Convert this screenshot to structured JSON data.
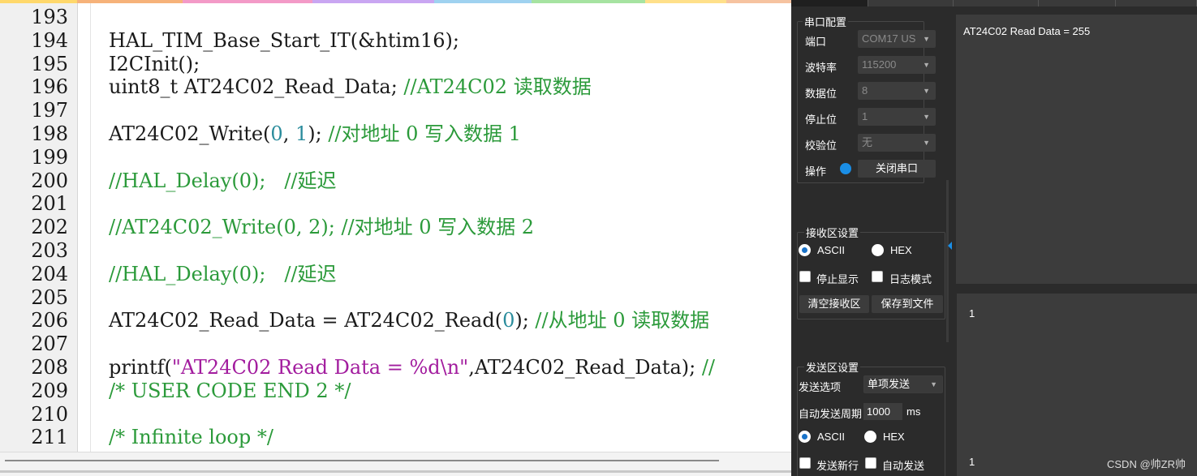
{
  "editor": {
    "tab_colors": [
      "#ffd86b",
      "#f6b27a",
      "#f39ac7",
      "#c9a6f2",
      "#9fd2f0",
      "#a6e3a1",
      "#ffe08a",
      "#f6c3a0"
    ],
    "lines": [
      {
        "n": "193",
        "tokens": []
      },
      {
        "n": "194",
        "tokens": [
          {
            "t": "HAL_TIM_Base_Start_IT(&htim16);",
            "c": ""
          }
        ]
      },
      {
        "n": "195",
        "tokens": [
          {
            "t": "I2CInit();",
            "c": ""
          }
        ]
      },
      {
        "n": "196",
        "tokens": [
          {
            "t": "uint8_t AT24C02_Read_Data; ",
            "c": ""
          },
          {
            "t": "//AT24C02 读取数据",
            "c": "cm"
          }
        ]
      },
      {
        "n": "197",
        "tokens": []
      },
      {
        "n": "198",
        "tokens": [
          {
            "t": "AT24C02_Write(",
            "c": ""
          },
          {
            "t": "0",
            "c": "num"
          },
          {
            "t": ", ",
            "c": ""
          },
          {
            "t": "1",
            "c": "num"
          },
          {
            "t": "); ",
            "c": ""
          },
          {
            "t": "//对地址 0 写入数据 1",
            "c": "cm"
          }
        ]
      },
      {
        "n": "199",
        "tokens": []
      },
      {
        "n": "200",
        "tokens": [
          {
            "t": "//HAL_Delay(0);   //延迟",
            "c": "cm"
          }
        ]
      },
      {
        "n": "201",
        "tokens": []
      },
      {
        "n": "202",
        "tokens": [
          {
            "t": "//AT24C02_Write(0, 2); //对地址 0 写入数据 2",
            "c": "cm"
          }
        ]
      },
      {
        "n": "203",
        "tokens": []
      },
      {
        "n": "204",
        "tokens": [
          {
            "t": "//HAL_Delay(0);   //延迟",
            "c": "cm"
          }
        ]
      },
      {
        "n": "205",
        "tokens": []
      },
      {
        "n": "206",
        "tokens": [
          {
            "t": "AT24C02_Read_Data = AT24C02_Read(",
            "c": ""
          },
          {
            "t": "0",
            "c": "num"
          },
          {
            "t": "); ",
            "c": ""
          },
          {
            "t": "//从地址 0 读取数据",
            "c": "cm"
          }
        ]
      },
      {
        "n": "207",
        "tokens": []
      },
      {
        "n": "208",
        "tokens": [
          {
            "t": "printf(",
            "c": ""
          },
          {
            "t": "\"AT24C02 Read Data = %d\\n\"",
            "c": "str"
          },
          {
            "t": ",AT24C02_Read_Data); ",
            "c": ""
          },
          {
            "t": "//",
            "c": "cm"
          }
        ]
      },
      {
        "n": "209",
        "tokens": [
          {
            "t": "/* USER CODE END 2 */",
            "c": "cm"
          }
        ]
      },
      {
        "n": "210",
        "tokens": []
      },
      {
        "n": "211",
        "tokens": [
          {
            "t": "/* Infinite loop */",
            "c": "cm"
          }
        ]
      }
    ]
  },
  "serial": {
    "port_group_title": "串口配置",
    "port_label": "端口",
    "port_value": "COM17 US",
    "baud_label": "波特率",
    "baud_value": "115200",
    "databits_label": "数据位",
    "databits_value": "8",
    "stopbits_label": "停止位",
    "stopbits_value": "1",
    "parity_label": "校验位",
    "parity_value": "无",
    "operate_label": "操作",
    "close_port_button": "关闭串口",
    "recv_group_title": "接收区设置",
    "recv_ascii": "ASCII",
    "recv_hex": "HEX",
    "stop_display": "停止显示",
    "log_mode": "日志模式",
    "clear_recv_button": "清空接收区",
    "save_to_file_button": "保存到文件",
    "send_group_title": "发送区设置",
    "send_option_label": "发送选项",
    "send_option_value": "单项发送",
    "auto_period_label": "自动发送周期",
    "auto_period_value": "1000",
    "auto_period_unit": "ms",
    "send_ascii": "ASCII",
    "send_hex": "HEX",
    "send_newline": "发送新行",
    "auto_send": "自动发送",
    "receive_text": "AT24C02 Read Data = 255",
    "send_text": "1",
    "send_line_text": "1",
    "accent_color": "#1a8ee6"
  },
  "watermark": "CSDN @帅ZR帅"
}
